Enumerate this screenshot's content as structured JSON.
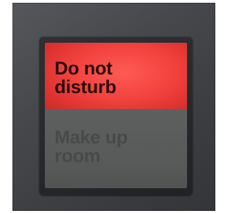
{
  "switch": {
    "top_button": {
      "lines": [
        "Do not",
        "disturb"
      ],
      "state": "lit",
      "color": "#f2423e"
    },
    "bottom_button": {
      "lines": [
        "Make up",
        "room"
      ],
      "state": "unlit",
      "color": "#5a5b5b"
    },
    "plate_color": "#46484c",
    "frame_color": "#26282b"
  }
}
